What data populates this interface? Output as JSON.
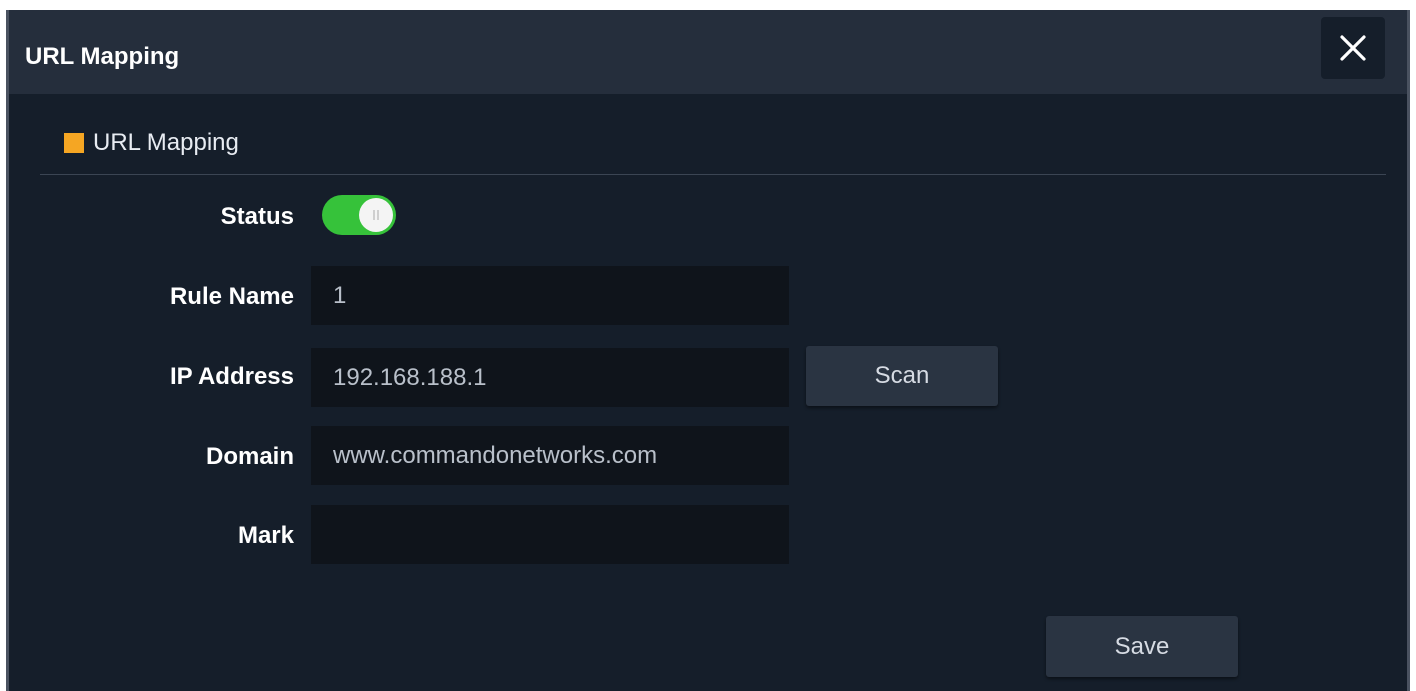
{
  "dialog": {
    "title": "URL Mapping",
    "close_icon": "close-icon"
  },
  "section": {
    "title": "URL Mapping",
    "marker_color": "#f5a623"
  },
  "form": {
    "status": {
      "label": "Status",
      "enabled": true,
      "on_color": "#36c23a"
    },
    "rule_name": {
      "label": "Rule Name",
      "value": "1"
    },
    "ip_address": {
      "label": "IP Address",
      "value": "192.168.188.1"
    },
    "domain": {
      "label": "Domain",
      "value": "www.commandonetworks.com"
    },
    "mark": {
      "label": "Mark",
      "value": ""
    }
  },
  "buttons": {
    "scan": "Scan",
    "save": "Save"
  }
}
